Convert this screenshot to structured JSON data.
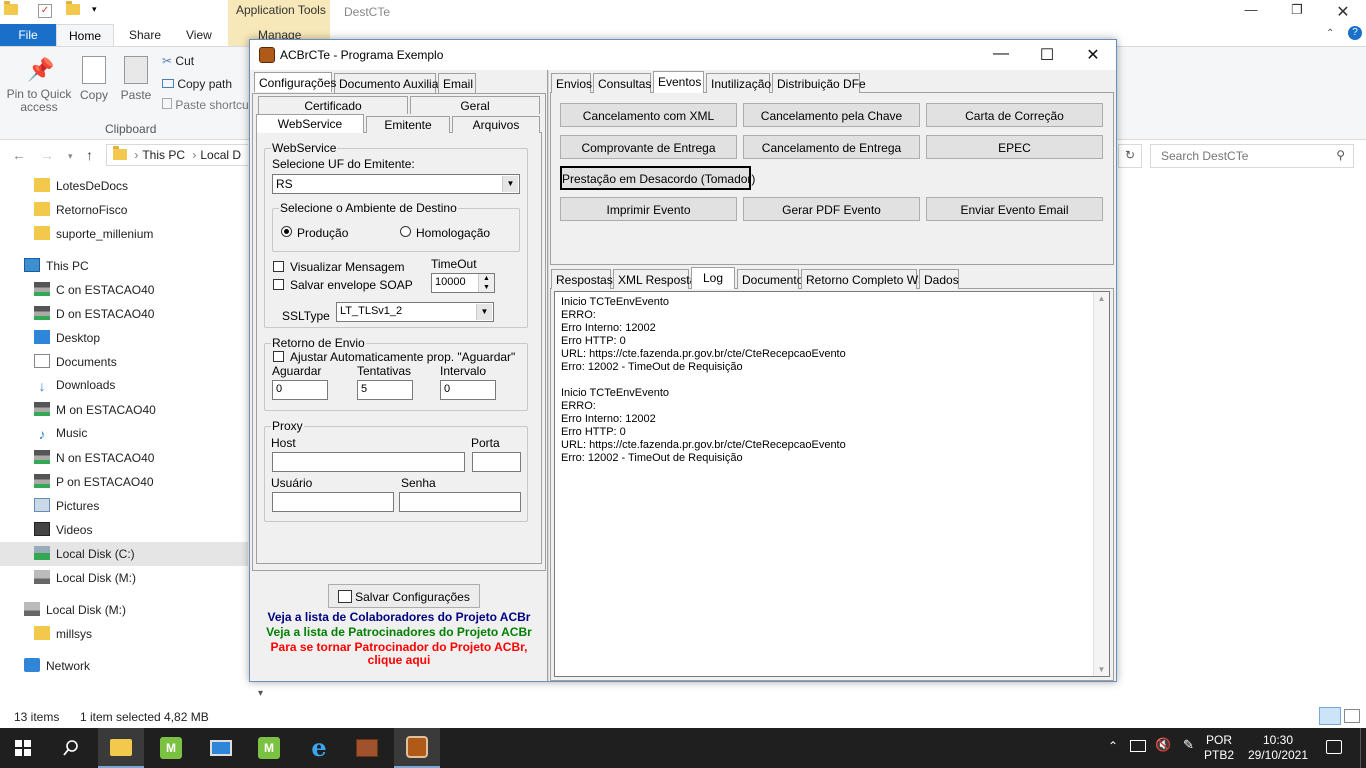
{
  "explorer": {
    "app_tools_label": "Application Tools",
    "window_name": "DestCTe",
    "tabs": {
      "file": "File",
      "home": "Home",
      "share": "Share",
      "view": "View",
      "manage": "Manage"
    },
    "ribbon": {
      "pin_label": "Pin to Quick access",
      "copy_label": "Copy",
      "paste_label": "Paste",
      "cut_label": "Cut",
      "copy_path_label": "Copy path",
      "paste_shortcut_label": "Paste shortcut",
      "group_clipboard": "Clipboard"
    },
    "breadcrumb": {
      "this_pc": "This PC",
      "local": "Local D"
    },
    "search_placeholder": "Search DestCTe",
    "nav": {
      "items": [
        {
          "label": "LotesDeDocs"
        },
        {
          "label": "RetornoFisco"
        },
        {
          "label": "suporte_millenium"
        },
        {
          "label": "This PC"
        },
        {
          "label": "C on ESTACAO40"
        },
        {
          "label": "D on ESTACAO40"
        },
        {
          "label": "Desktop"
        },
        {
          "label": "Documents"
        },
        {
          "label": "Downloads"
        },
        {
          "label": "M on ESTACAO40"
        },
        {
          "label": "Music"
        },
        {
          "label": "N on ESTACAO40"
        },
        {
          "label": "P on ESTACAO40"
        },
        {
          "label": "Pictures"
        },
        {
          "label": "Videos"
        },
        {
          "label": "Local Disk (C:)"
        },
        {
          "label": "Local Disk (M:)"
        },
        {
          "label": "Local Disk (M:)"
        },
        {
          "label": "millsys"
        },
        {
          "label": "Network"
        }
      ]
    },
    "status": {
      "count": "13 items",
      "selection": "1 item selected  4,82 MB"
    }
  },
  "acbr": {
    "title": "ACBrCTe - Programa Exemplo",
    "left_tabs": [
      "Configurações",
      "Documento Auxiliar",
      "Email"
    ],
    "sub_tabs_row1": [
      "Certificado",
      "Geral"
    ],
    "sub_tabs_row2": [
      "WebService",
      "Emitente",
      "Arquivos"
    ],
    "webservice": {
      "group_title": "WebService",
      "uf_label": "Selecione UF do Emitente:",
      "uf_value": "RS",
      "ambiente_title": "Selecione o Ambiente de Destino",
      "producao": "Produção",
      "homologacao": "Homologação",
      "visualizar": "Visualizar Mensagem",
      "salvar_envelope": "Salvar envelope SOAP",
      "timeout_label": "TimeOut",
      "timeout_value": "10000",
      "ssltype_label": "SSLType",
      "ssltype_value": "LT_TLSv1_2"
    },
    "retorno": {
      "group_title": "Retorno de Envio",
      "ajustar": "Ajustar Automaticamente prop. \"Aguardar\"",
      "aguardar_label": "Aguardar",
      "tentativas_label": "Tentativas",
      "intervalo_label": "Intervalo",
      "aguardar_value": "0",
      "tentativas_value": "5",
      "intervalo_value": "0"
    },
    "proxy": {
      "group_title": "Proxy",
      "host_label": "Host",
      "porta_label": "Porta",
      "usuario_label": "Usuário",
      "senha_label": "Senha"
    },
    "salvar_btn": "Salvar Configurações",
    "links": {
      "colaboradores": "Veja a lista de Colaboradores do Projeto ACBr",
      "patrocinadores": "Veja a lista de Patrocinadores do Projeto ACBr",
      "tornar1": "Para se tornar Patrocinador do Projeto ACBr,",
      "tornar2": "clique aqui"
    },
    "right_tabs": [
      "Envios",
      "Consultas",
      "Eventos",
      "Inutilização",
      "Distribuição DFe"
    ],
    "event_buttons": {
      "cancel_xml": "Cancelamento com XML",
      "cancel_chave": "Cancelamento pela Chave",
      "carta": "Carta de Correção",
      "comprovante": "Comprovante de Entrega",
      "cancel_entrega": "Cancelamento de Entrega",
      "epec": "EPEC",
      "prestacao": "Prestação em Desacordo (Tomador)",
      "imprimir": "Imprimir Evento",
      "gerar_pdf": "Gerar PDF Evento",
      "enviar_email": "Enviar Evento Email"
    },
    "bottom_tabs": [
      "Respostas",
      "XML Resposta",
      "Log",
      "Documento",
      "Retorno Completo WS",
      "Dados"
    ],
    "log_text": "Inicio TCTeEnvEvento\nERRO:\nErro Interno: 12002\nErro HTTP: 0\nURL: https://cte.fazenda.pr.gov.br/cte/CteRecepcaoEvento\nErro: 12002 - TimeOut de Requisição\n\nInicio TCTeEnvEvento\nERRO:\nErro Interno: 12002\nErro HTTP: 0\nURL: https://cte.fazenda.pr.gov.br/cte/CteRecepcaoEvento\nErro: 12002 - TimeOut de Requisição"
  },
  "taskbar": {
    "lang1": "POR",
    "lang2": "PTB2",
    "time": "10:30",
    "date": "29/10/2021"
  },
  "colors": {
    "file_tab": "#1a6fc9",
    "app_tools": "#f6e8b8",
    "link_blue": "#000080",
    "link_green": "#008000",
    "link_red": "#ff0000"
  }
}
